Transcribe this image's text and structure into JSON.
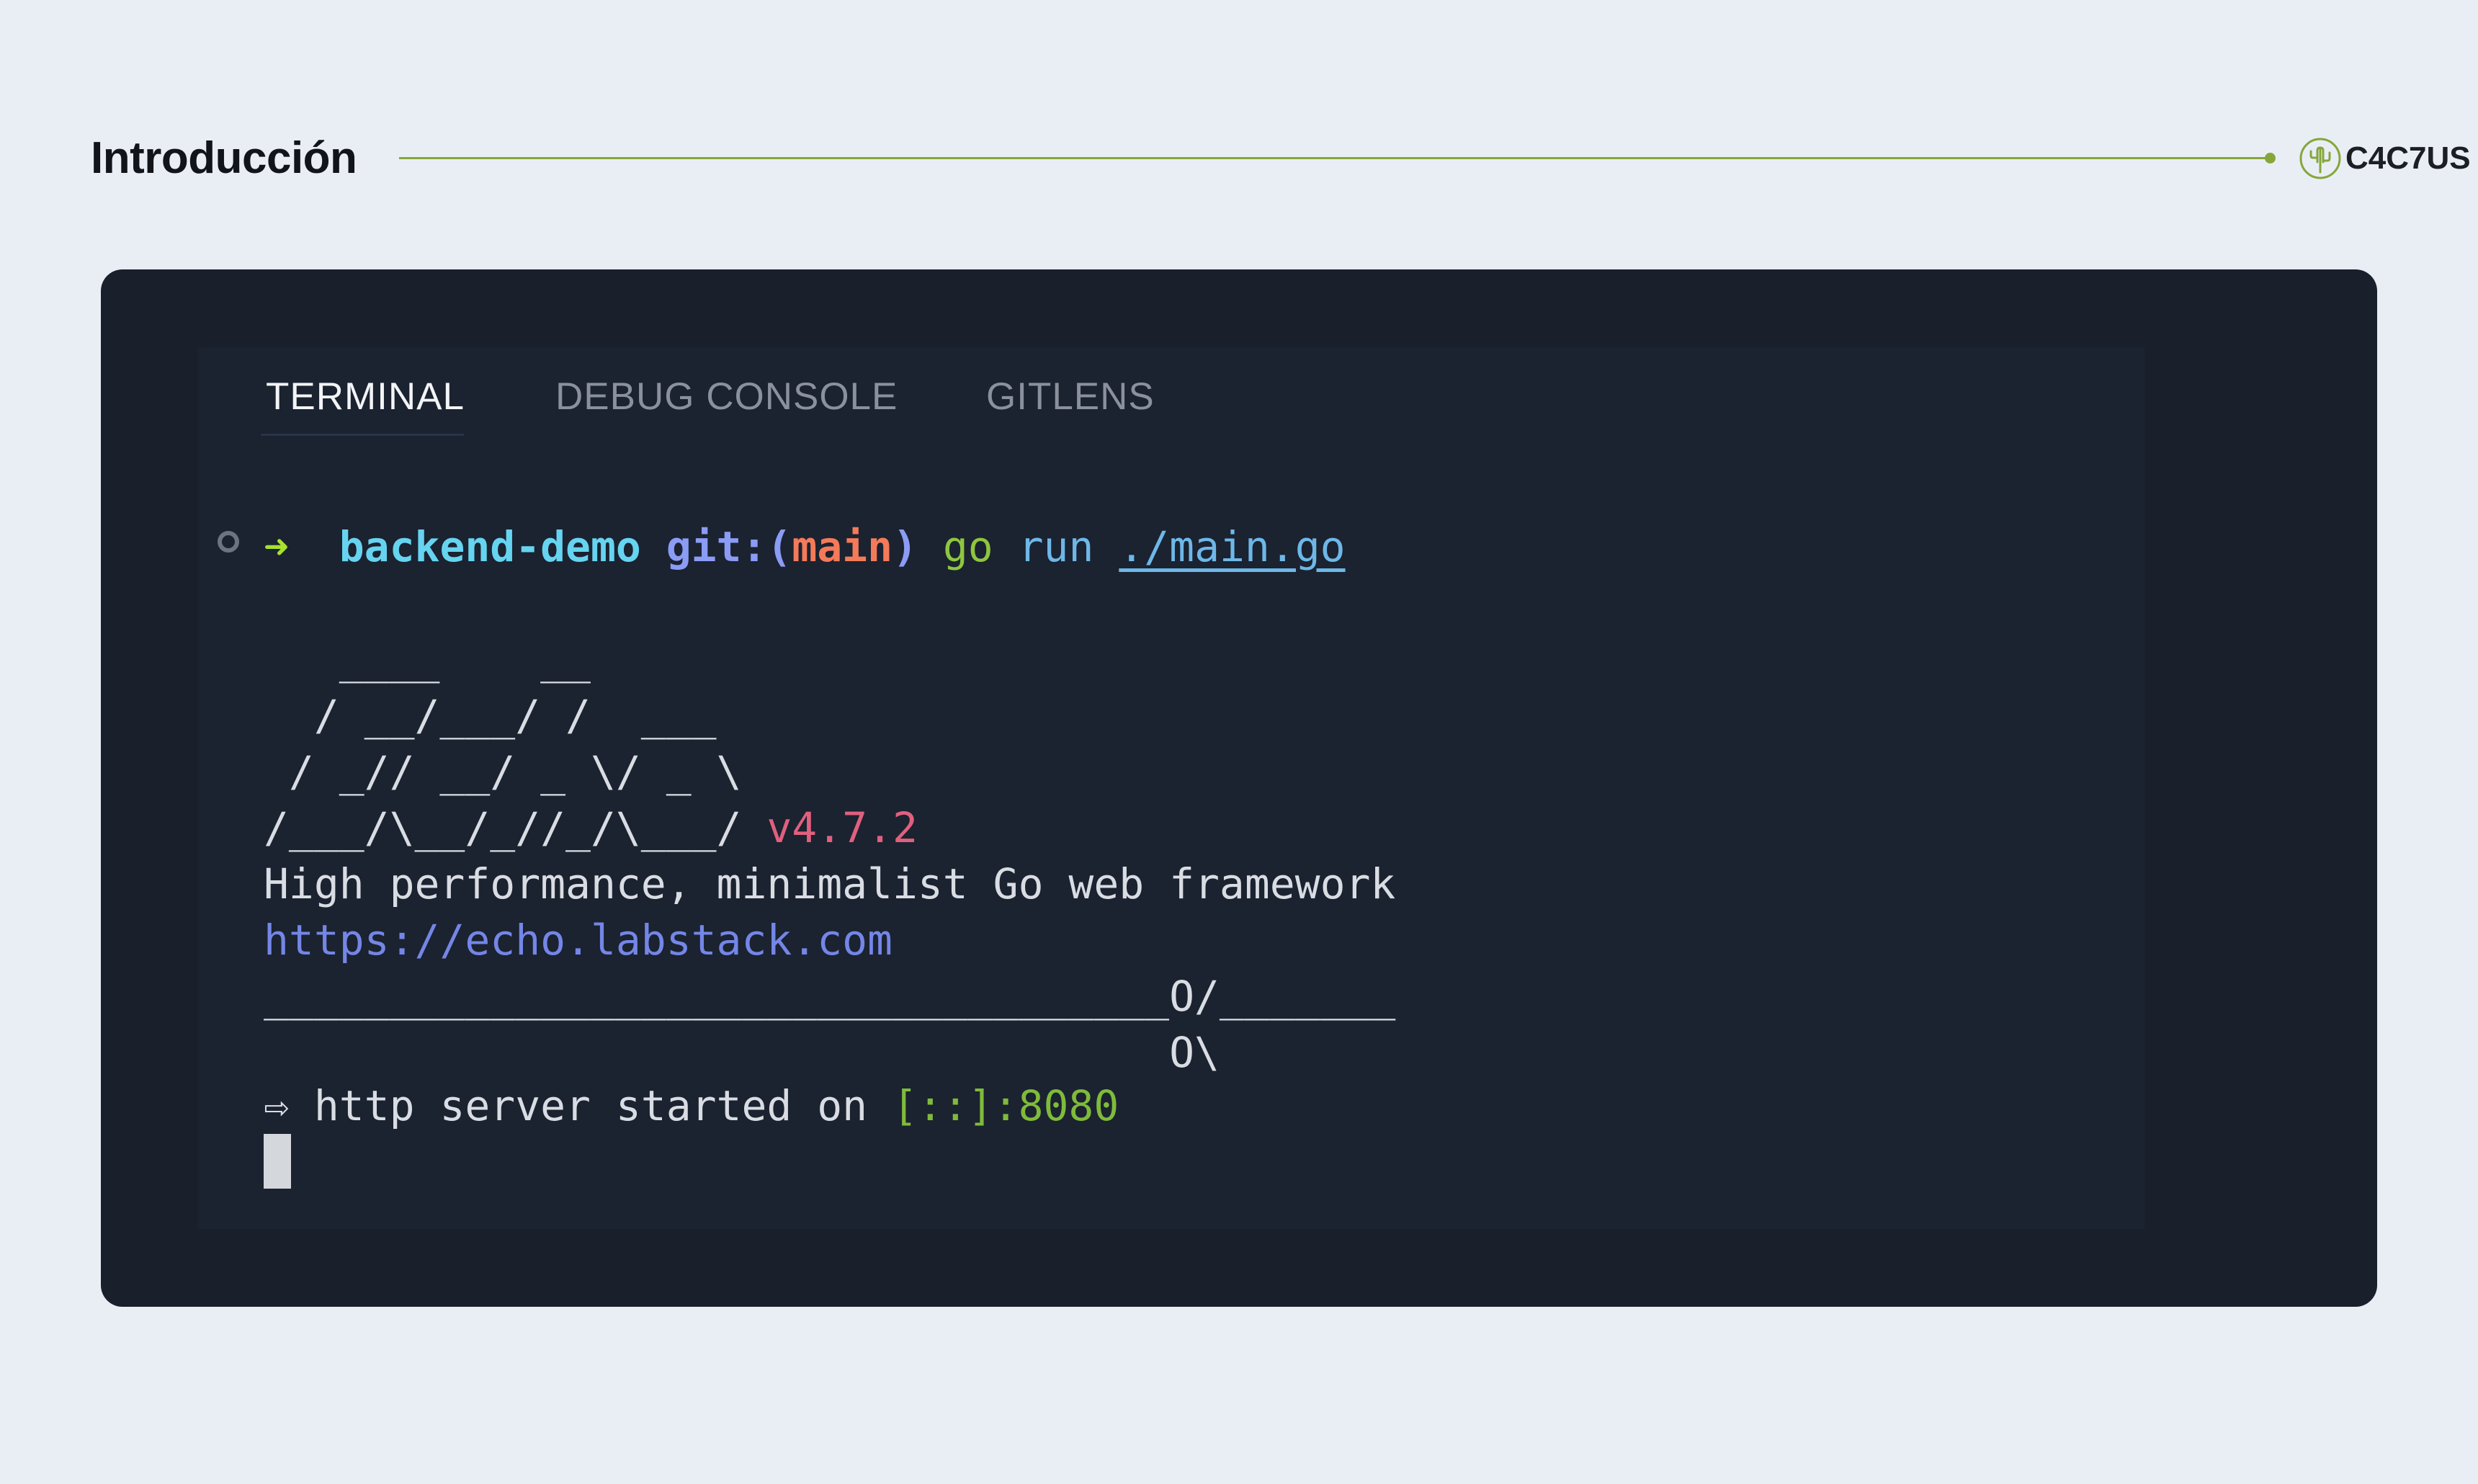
{
  "header": {
    "title": "Introducción",
    "brand_name": "C4C7US",
    "accent_color": "#86a63a"
  },
  "terminal": {
    "tabs": [
      {
        "label": "TERMINAL",
        "active": true
      },
      {
        "label": "DEBUG CONSOLE",
        "active": false
      },
      {
        "label": "GITLENS",
        "active": false
      }
    ],
    "prompt": {
      "status_icon": "circle-icon",
      "arrow": "➜",
      "directory": "backend-demo",
      "git_prefix": "git:(",
      "branch": "main",
      "git_suffix": ")",
      "command": "go",
      "subcommand": "run",
      "path": "./main.go"
    },
    "banner": [
      "   ____    __",
      "  / __/___/ /  ___",
      " / _// __/ _ \\/ _ \\",
      "/___/\\__/_//_/\\___/"
    ],
    "version": "v4.7.2",
    "tagline": "High performance, minimalist Go web framework",
    "url": "https://echo.labstack.com",
    "divider_top": "____________________________________O/_______",
    "divider_bottom": "                                    O\\",
    "server_arrow": "⇨",
    "server_text": "http server started on",
    "server_address": "[::]:8080"
  },
  "colors": {
    "page_background": "#e9eef5",
    "terminal_background": "#19202c",
    "arrow": "#a6e22e",
    "directory": "#66d4f0",
    "git": "#8b9cf5",
    "branch": "#f47a5a",
    "version": "#e0607e",
    "link": "#7486e6",
    "address": "#7fbb3a"
  }
}
